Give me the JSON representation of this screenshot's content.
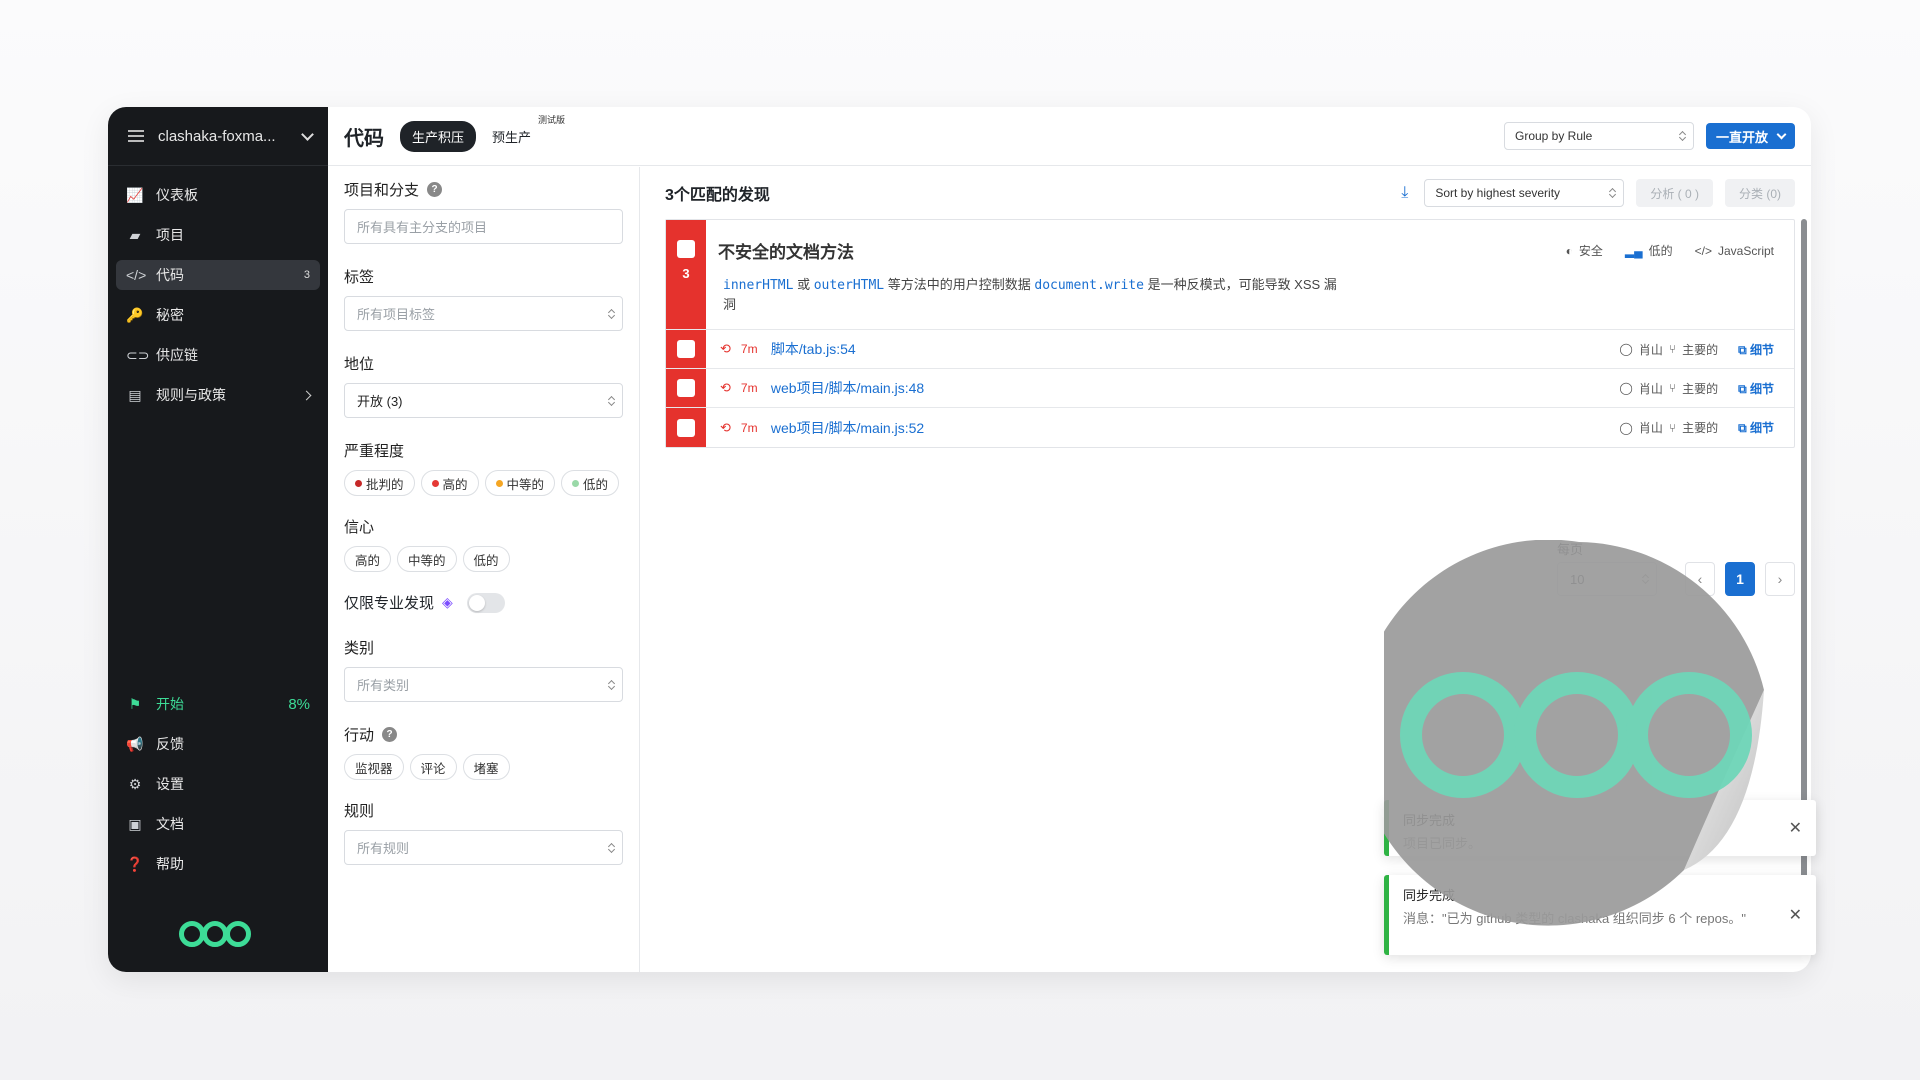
{
  "sidebar": {
    "org_name": "clashaka-foxma...",
    "items": [
      {
        "label": "仪表板",
        "icon": "chart-icon"
      },
      {
        "label": "项目",
        "icon": "folder-icon"
      },
      {
        "label": "代码",
        "icon": "code-icon",
        "count": "3"
      },
      {
        "label": "秘密",
        "icon": "key-icon"
      },
      {
        "label": "供应链",
        "icon": "link-icon"
      },
      {
        "label": "规则与政策",
        "icon": "policy-icon"
      }
    ],
    "bottom": {
      "start_label": "开始",
      "start_progress": "8%",
      "feedback": "反馈",
      "settings": "设置",
      "docs": "文档",
      "help": "帮助"
    }
  },
  "header": {
    "title": "代码",
    "tab_prod": "生产积压",
    "tab_preprod": "预生产",
    "beta": "测试版",
    "group_by": "Group by Rule",
    "status_button": "一直开放"
  },
  "filters": {
    "repo_label": "项目和分支",
    "repo_placeholder": "所有具有主分支的项目",
    "tags_label": "标签",
    "tags_placeholder": "所有项目标签",
    "status_label": "地位",
    "status_value": "开放 (3)",
    "severity_label": "严重程度",
    "severity": [
      "批判的",
      "高的",
      "中等的",
      "低的"
    ],
    "confidence_label": "信心",
    "confidence": [
      "高的",
      "中等的",
      "低的"
    ],
    "pro_label": "仅限专业发现",
    "category_label": "类别",
    "category_placeholder": "所有类别",
    "action_label": "行动",
    "actions": [
      "监视器",
      "评论",
      "堵塞"
    ],
    "rule_label": "规则",
    "rule_placeholder": "所有规则"
  },
  "results": {
    "count_title": "3个匹配的发现",
    "sort": "Sort by highest severity",
    "analyze": "分析 ( 0 )",
    "triage": "分类 (0)",
    "rule": {
      "title": "不安全的文档方法",
      "count": "3",
      "desc_code1": "innerHTML",
      "desc_or": " 或 ",
      "desc_code2": "outerHTML",
      "desc_mid": " 等方法中的用户控制数据 ",
      "desc_code3": "document.write",
      "desc_end": " 是一种反模式，可能导致 XSS 漏洞",
      "tag_category": "安全",
      "tag_confidence": "低的",
      "tag_lang": "JavaScript"
    },
    "findings": [
      {
        "age": "7m",
        "path": "脚本/tab.js:54",
        "repo": "肖山",
        "branch": "主要的",
        "detail": "细节"
      },
      {
        "age": "7m",
        "path": "web项目/脚本/main.js:48",
        "repo": "肖山",
        "branch": "主要的",
        "detail": "细节"
      },
      {
        "age": "7m",
        "path": "web项目/脚本/main.js:52",
        "repo": "肖山",
        "branch": "主要的",
        "detail": "细节"
      }
    ],
    "per_page_label": "每页",
    "per_page": "10",
    "page": "1"
  },
  "toasts": [
    {
      "title": "同步完成",
      "message": "项目已同步。"
    },
    {
      "title": "同步完成",
      "message": "消息：\"已为 github 类型的 clashaka 组织同步 6 个 repos。\""
    }
  ],
  "colors": {
    "sidebar_bg": "#17191c",
    "accent": "#1a6fd1",
    "critical": "#e5322d",
    "brand": "#3ddc97",
    "success": "#2fb344"
  }
}
